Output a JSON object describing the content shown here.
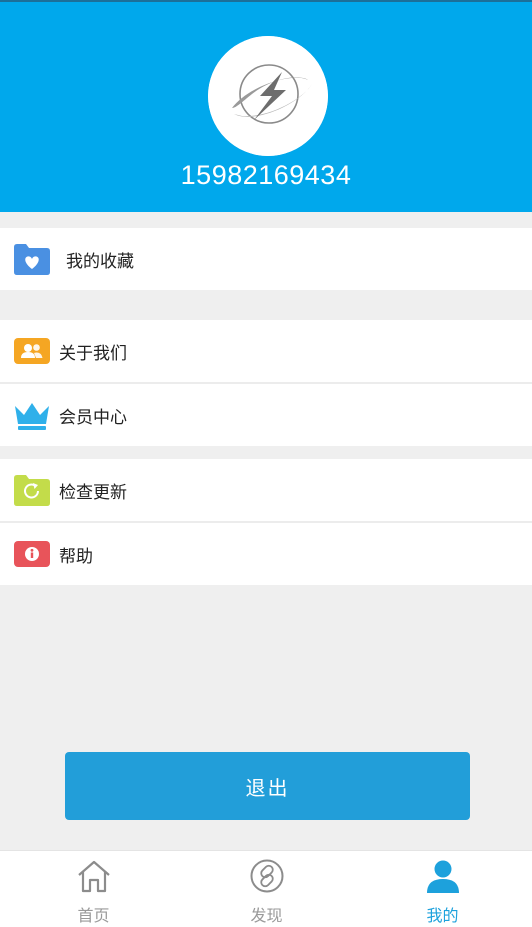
{
  "colors": {
    "header_bg": "#00a8ec",
    "accent": "#229ed9",
    "tab_active": "#1da1dc",
    "tab_inactive": "#9a9a9a",
    "background": "#efefef"
  },
  "profile": {
    "avatar_icon": "app-logo-icon",
    "phone": "15982169434"
  },
  "menu": {
    "favorites": {
      "label": "我的收藏",
      "icon": "folder-heart-icon"
    },
    "about": {
      "label": "关于我们",
      "icon": "users-icon"
    },
    "member": {
      "label": "会员中心",
      "icon": "crown-icon"
    },
    "update": {
      "label": "检查更新",
      "icon": "refresh-folder-icon"
    },
    "help": {
      "label": "帮助",
      "icon": "info-icon"
    }
  },
  "logout": {
    "label": "退出"
  },
  "tabs": [
    {
      "label": "首页",
      "icon": "home-icon",
      "active": false
    },
    {
      "label": "发现",
      "icon": "discover-icon",
      "active": false
    },
    {
      "label": "我的",
      "icon": "user-icon",
      "active": true
    }
  ]
}
